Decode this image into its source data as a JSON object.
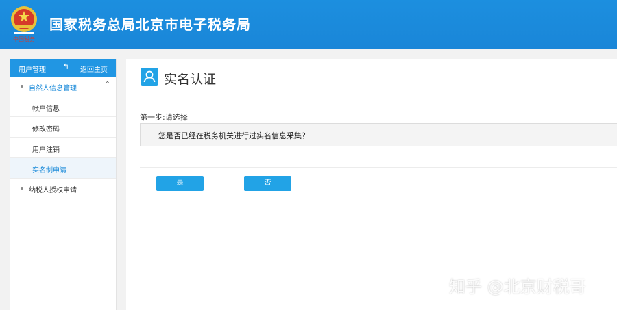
{
  "header": {
    "title": "国家税务总局北京市电子税务局",
    "emblem_text": "中国税务",
    "background_color": "#1a86d8"
  },
  "sidebar": {
    "title": "用户管理",
    "back_label": "返回主页",
    "groups": [
      {
        "label": "自然人信息管理",
        "expanded": true,
        "items": [
          {
            "label": "帐户信息"
          },
          {
            "label": "修改密码"
          },
          {
            "label": "用户注销"
          },
          {
            "label": "实名制申请",
            "active": true
          }
        ]
      },
      {
        "label": "纳税人授权申请",
        "expanded": false
      }
    ]
  },
  "main": {
    "icon": "user-icon",
    "title": "实名认证",
    "step_label": "第一步:请选择",
    "question": "您是否已经在税务机关进行过实名信息采集？",
    "yes_label": "是",
    "no_label": "否",
    "accent_color": "#22a3e6"
  },
  "watermark": "知乎 @北京财税哥"
}
